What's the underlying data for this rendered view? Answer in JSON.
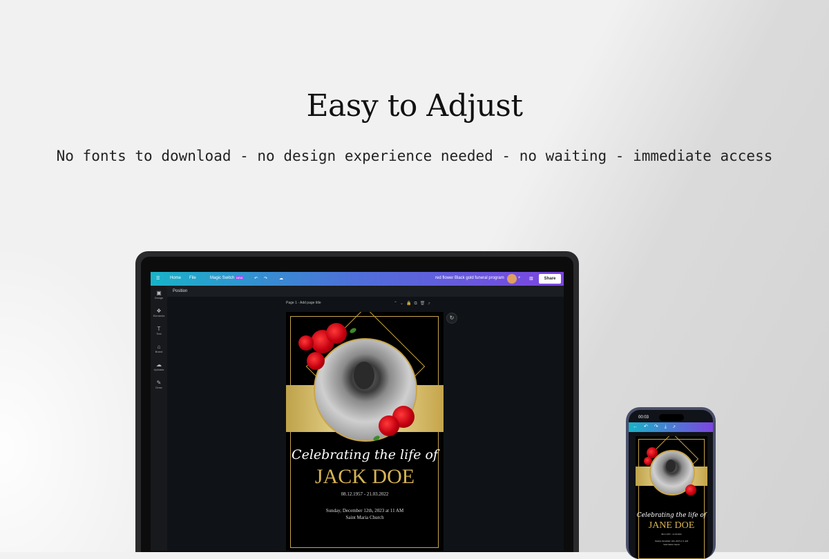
{
  "headline": "Easy to Adjust",
  "subline": "No fonts to download - no design experience needed - no waiting - immediate access",
  "editor": {
    "menu_icon": "☰",
    "home_label": "Home",
    "file_label": "File",
    "magic_switch_label": "Magic Switch",
    "new_badge": "NEW",
    "undo_icon": "↶",
    "redo_icon": "↷",
    "cloud_icon": "☁",
    "doc_title": "red flower  Black gold funeral program",
    "plus": "+",
    "chart_icon": "▥",
    "share_label": "Share",
    "position_label": "Position",
    "page_label": "Page 1 - Add page title",
    "page_icons": "⌃⌄🔒⧉🗑⤴",
    "refresh_icon": "↻",
    "sidebar": [
      {
        "icon": "▣",
        "label": "Design"
      },
      {
        "icon": "❖",
        "label": "Elements"
      },
      {
        "icon": "T",
        "label": "Text"
      },
      {
        "icon": "⌂",
        "label": "Brand"
      },
      {
        "icon": "☁",
        "label": "Uploads"
      },
      {
        "icon": "✎",
        "label": "Draw"
      }
    ]
  },
  "program_laptop": {
    "script": "Celebrating the life of",
    "name": "JACK DOE",
    "dates": "08.12.1957 - 21.03.2022",
    "service": "Sunday, December 12th, 2023 at 11 AM",
    "place": "Saint Maria Church"
  },
  "phone": {
    "time": "00:03",
    "icons": "←↶↷⤓⤴",
    "script": "Celebrating the life of",
    "name": "JANE DOE",
    "dates": "08.12.1957 - 21.03.2022",
    "service": "Sunday, December 12th, 2023 at 11 AM",
    "place": "Saint Maria Church"
  }
}
